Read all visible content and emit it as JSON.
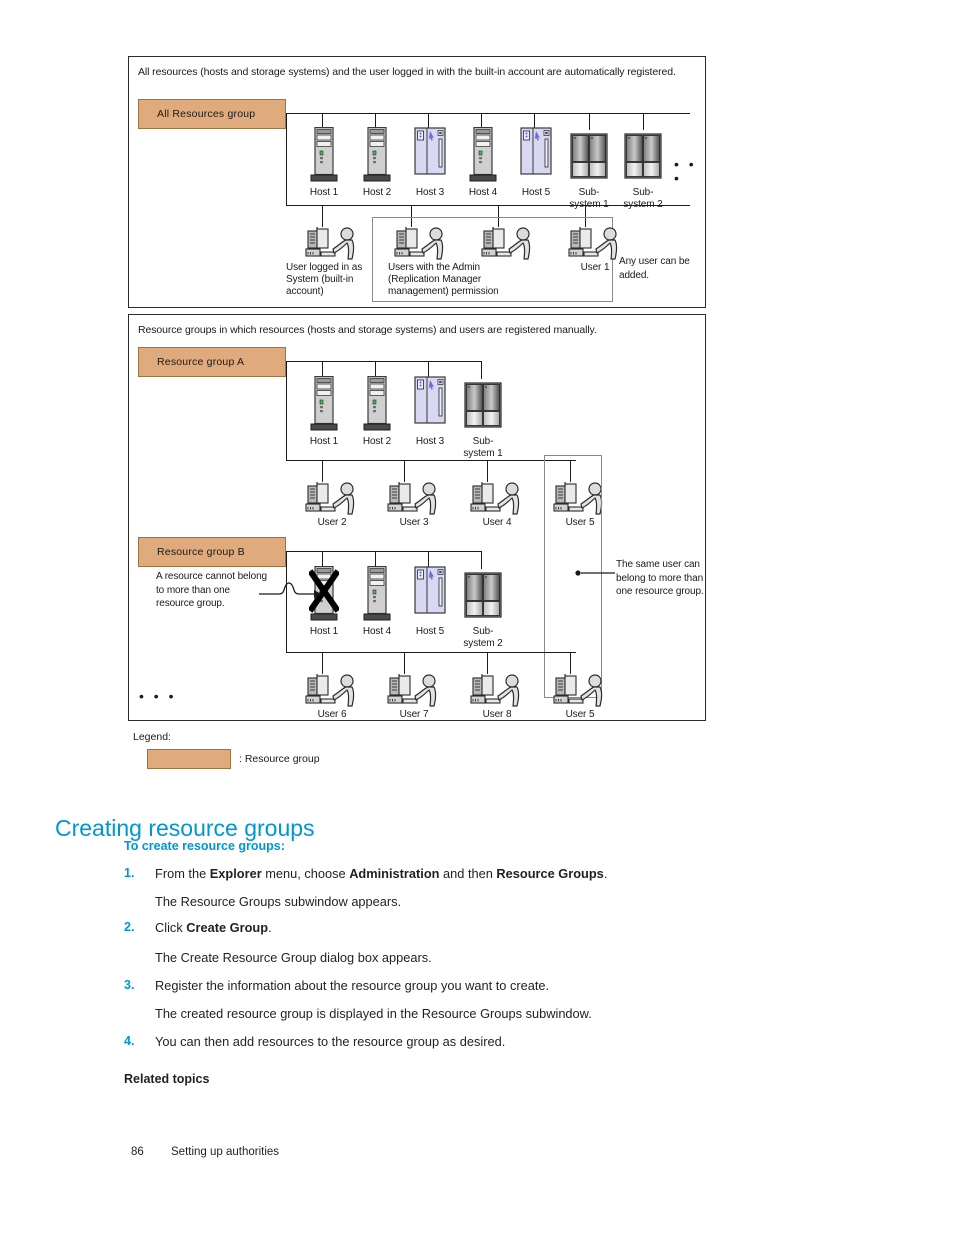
{
  "figure": {
    "top_box": {
      "caption": "All resources (hosts and storage systems) and the user logged in with the built-in account are automatically registered.",
      "group_chip": "All Resources group",
      "resources": [
        {
          "label": "Host 1",
          "icon": "server-tower-icon"
        },
        {
          "label": "Host 2",
          "icon": "server-tower-icon"
        },
        {
          "label": "Host 3",
          "icon": "workstation-icon"
        },
        {
          "label": "Host 4",
          "icon": "server-tower-icon"
        },
        {
          "label": "Host 5",
          "icon": "workstation-icon"
        },
        {
          "label": "Sub-\nsystem 1",
          "icon": "storage-subsystem-icon"
        },
        {
          "label": "Sub-\nsystem 2",
          "icon": "storage-subsystem-icon"
        }
      ],
      "resources_ellipsis": "• • •",
      "users": [
        {
          "label": "User logged in as\nSystem (built-in\naccount)",
          "icon": "user-at-computer-icon"
        },
        {
          "label": "Users with the Admin\n(Replication Manager\nmanagement) permission",
          "icon": "user-at-computer-icon"
        },
        {
          "label": "",
          "icon": "user-at-computer-icon"
        },
        {
          "label": "User 1",
          "icon": "user-at-computer-icon"
        }
      ],
      "annotation": "Any user can\nbe added."
    },
    "bottom_box": {
      "caption": "Resource groups in which resources (hosts and storage systems) and users are registered manually.",
      "group_a_chip": "Resource group A",
      "group_a_resources": [
        {
          "label": "Host 1",
          "icon": "server-tower-icon"
        },
        {
          "label": "Host 2",
          "icon": "server-tower-icon"
        },
        {
          "label": "Host 3",
          "icon": "workstation-icon"
        },
        {
          "label": "Sub-\nsystem 1",
          "icon": "storage-subsystem-icon"
        }
      ],
      "group_a_users": [
        {
          "label": "User 2",
          "icon": "user-at-computer-icon"
        },
        {
          "label": "User 3",
          "icon": "user-at-computer-icon"
        },
        {
          "label": "User 4",
          "icon": "user-at-computer-icon"
        },
        {
          "label": "User 5",
          "icon": "user-at-computer-icon"
        }
      ],
      "group_b_chip": "Resource group B",
      "group_b_note": "A resource cannot\nbelong to more than\none resource group.",
      "group_b_resources": [
        {
          "label": "Host 1",
          "icon": "server-tower-icon",
          "crossed": true
        },
        {
          "label": "Host 4",
          "icon": "server-tower-icon"
        },
        {
          "label": "Host 5",
          "icon": "workstation-icon"
        },
        {
          "label": "Sub-\nsystem 2",
          "icon": "storage-subsystem-icon"
        }
      ],
      "group_b_users": [
        {
          "label": "User 6",
          "icon": "user-at-computer-icon"
        },
        {
          "label": "User 7",
          "icon": "user-at-computer-icon"
        },
        {
          "label": "User 8",
          "icon": "user-at-computer-icon"
        },
        {
          "label": "User 5",
          "icon": "user-at-computer-icon"
        }
      ],
      "shared_user_annotation": "The same user\ncan belong to\nmore than one\nresource group.",
      "bottom_ellipsis": "• • •"
    },
    "legend": {
      "title": "Legend:",
      "swatch_text": ": Resource group"
    },
    "colors": {
      "resource_group": "#dfab7d",
      "resource_group_border": "#9e7346",
      "accent_blue": "#0096d6"
    }
  },
  "content": {
    "heading": "Creating resource groups",
    "subheading": "To create resource groups:",
    "steps": [
      {
        "num": "1.",
        "text_parts": [
          {
            "t": "From the ",
            "b": false
          },
          {
            "t": "Explorer",
            "b": true
          },
          {
            "t": " menu, choose ",
            "b": false
          },
          {
            "t": "Administration",
            "b": true
          },
          {
            "t": " and then ",
            "b": false
          },
          {
            "t": "Resource Groups",
            "b": true
          },
          {
            "t": ".",
            "b": false
          }
        ],
        "result": "The Resource Groups subwindow appears."
      },
      {
        "num": "2.",
        "text_parts": [
          {
            "t": "Click ",
            "b": false
          },
          {
            "t": "Create Group",
            "b": true
          },
          {
            "t": ".",
            "b": false
          }
        ],
        "result": "The Create Resource Group dialog box appears."
      },
      {
        "num": "3.",
        "text_parts": [
          {
            "t": "Register the information about the resource group you want to create.",
            "b": false
          }
        ],
        "result": "The created resource group is displayed in the Resource Groups subwindow."
      },
      {
        "num": "4.",
        "text_parts": [
          {
            "t": "You can then add resources to the resource group as desired.",
            "b": false
          }
        ],
        "result": ""
      }
    ],
    "related_topics": "Related topics"
  },
  "footer": {
    "page_number": "86",
    "section_title": "Setting up authorities"
  }
}
